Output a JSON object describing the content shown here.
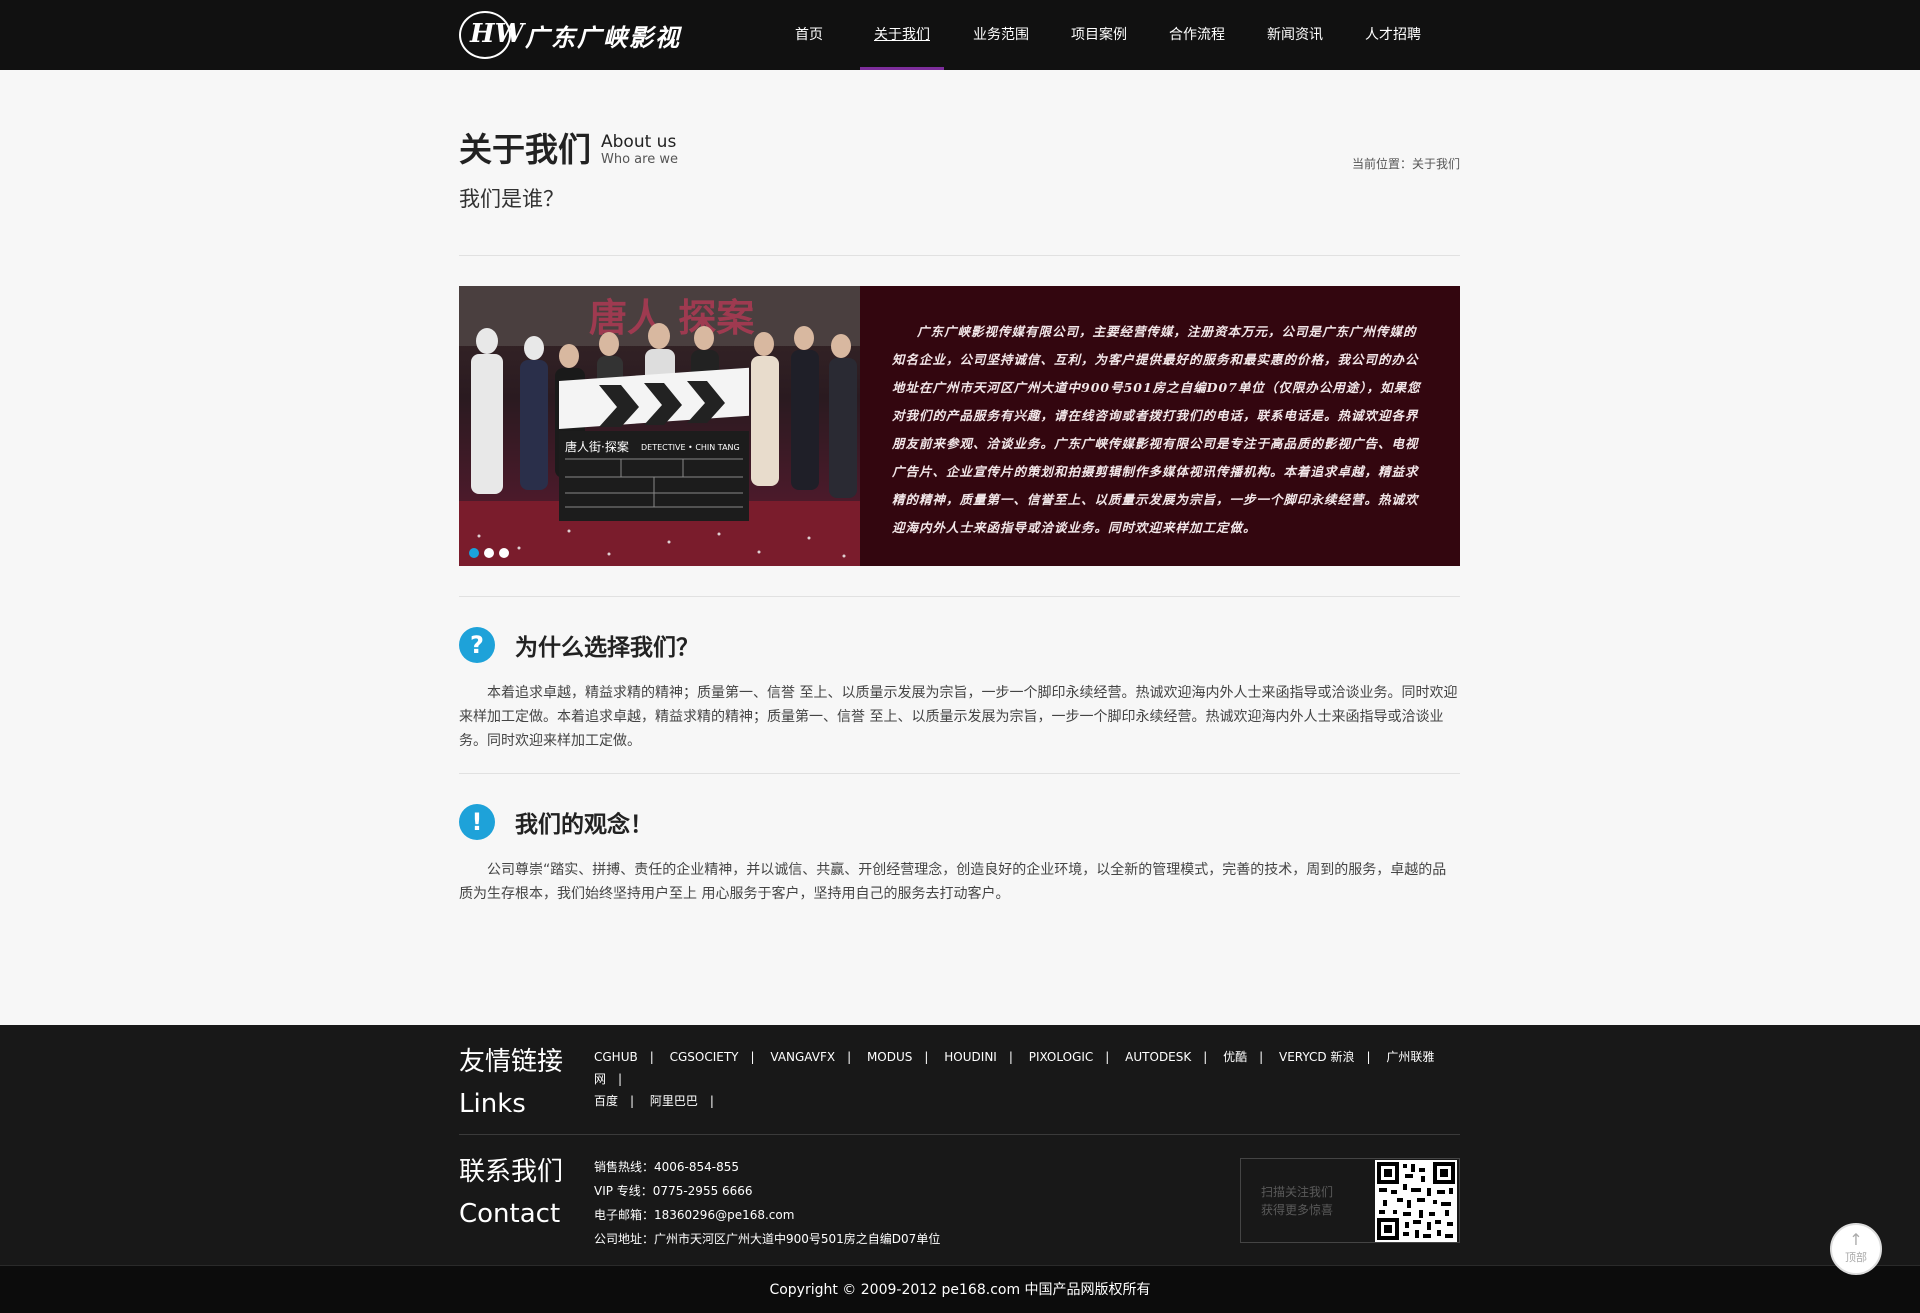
{
  "header": {
    "logo_mark": "HW",
    "logo_text": "广东广峡影视",
    "nav": [
      {
        "label": "首页"
      },
      {
        "label": "关于我们",
        "active": true
      },
      {
        "label": "业务范围"
      },
      {
        "label": "项目案例"
      },
      {
        "label": "合作流程"
      },
      {
        "label": "新闻资讯"
      },
      {
        "label": "人才招聘"
      }
    ]
  },
  "page": {
    "title_cn": "关于我们",
    "title_en": "About us",
    "title_en_sub": "Who are we",
    "subtitle": "我们是谁？",
    "breadcrumb": "当前位置：关于我们"
  },
  "banner": {
    "clapper_title": "唐人街·探案",
    "clapper_en": "DETECTIVE • CHIN TANG",
    "text": "广东广峡影视传媒有限公司，主要经营传媒，注册资本万元，公司是广东广州传媒的知名企业，公司坚持诚信、互利，为客户提供最好的服务和最实惠的价格，我公司的办公地址在广州市天河区广州大道中900号501房之自编D07单位（仅限办公用途），如果您对我们的产品服务有兴趣，请在线咨询或者拨打我们的电话，联系电话是。热诚欢迎各界朋友前来参观、洽谈业务。广东广峡传媒影视有限公司是专注于高品质的影视广告、电视广告片、企业宣传片的策划和拍摄剪辑制作多媒体视讯传播机构。本着追求卓越，精益求精的精神，质量第一、信誉至上、以质量示发展为宗旨，一步一个脚印永续经营。热诚欢迎海内外人士来函指导或洽谈业务。同时欢迎来样加工定做。"
  },
  "sections": [
    {
      "icon": "?",
      "title": "为什么选择我们？",
      "body": "本着追求卓越，精益求精的精神；质量第一、信誉 至上、以质量示发展为宗旨，一步一个脚印永续经营。热诚欢迎海内外人士来函指导或洽谈业务。同时欢迎来样加工定做。本着追求卓越，精益求精的精神；质量第一、信誉 至上、以质量示发展为宗旨，一步一个脚印永续经营。热诚欢迎海内外人士来函指导或洽谈业务。同时欢迎来样加工定做。"
    },
    {
      "icon": "!",
      "title": "我们的观念！",
      "body": "公司尊崇“踏实、拼搏、责任的企业精神，并以诚信、共赢、开创经营理念，创造良好的企业环境，以全新的管理模式，完善的技术，周到的服务，卓越的品质为生存根本，我们始终坚持用户至上 用心服务于客户，坚持用自己的服务去打动客户。"
    }
  ],
  "footer": {
    "links_label_cn": "友情链接",
    "links_label_en": "Links",
    "links": [
      "CGHUB",
      "CGSOCIETY",
      "VANGAVFX",
      "MODUS",
      "HOUDINI",
      "PIXOLOGIC",
      "AUTODESK",
      "优酷",
      "VERYCD 新浪",
      "广州联雅网",
      "百度",
      "阿里巴巴"
    ],
    "contact_label_cn": "联系我们",
    "contact_label_en": "Contact",
    "contact": {
      "hotline": "销售热线：4006-854-855",
      "vip": "VIP 专线：0775-2955 6666",
      "email": "电子邮箱：18360296@pe168.com",
      "address": "公司地址：广州市天河区广州大道中900号501房之自编D07单位"
    },
    "qr_text_1": "扫描关注我们",
    "qr_text_2": "获得更多惊喜",
    "copyright": "Copyright © 2009-2012 pe168.com 中国产品网版权所有",
    "back_top": "顶部"
  },
  "colors": {
    "header_bg": "#111111",
    "nav_active_underline": "#7d2e9c",
    "icon_blue": "#1ea2d9",
    "banner_text_bg": "#33060f",
    "footer_bg": "#181818"
  }
}
